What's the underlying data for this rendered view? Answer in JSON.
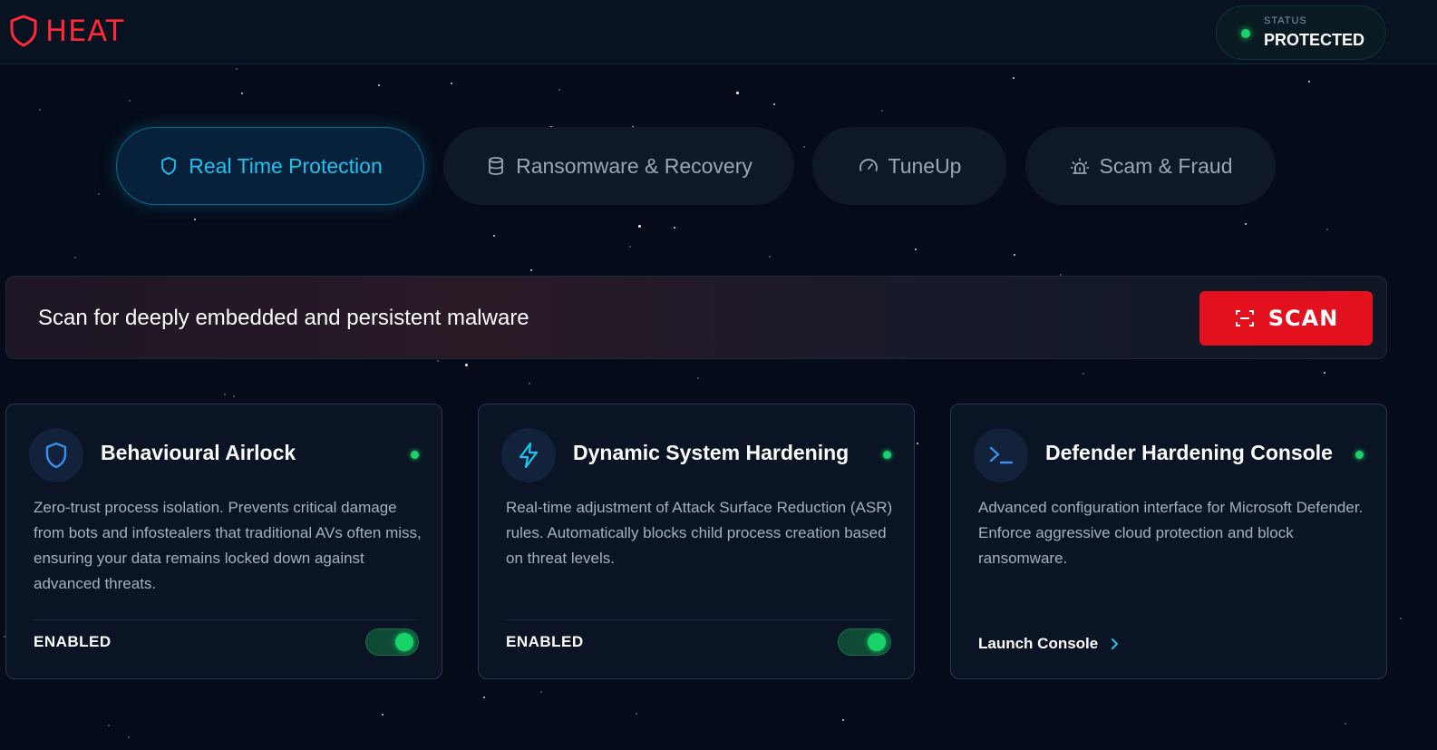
{
  "header": {
    "logo_text": "HEAT",
    "status_label": "STATUS",
    "status_value": "PROTECTED"
  },
  "tabs": [
    {
      "label": "Real Time Protection",
      "icon": "shield-icon",
      "active": true
    },
    {
      "label": "Ransomware & Recovery",
      "icon": "database-icon",
      "active": false
    },
    {
      "label": "TuneUp",
      "icon": "gauge-icon",
      "active": false
    },
    {
      "label": "Scam & Fraud",
      "icon": "alarm-icon",
      "active": false
    }
  ],
  "scan": {
    "text": "Scan for deeply embedded and persistent malware",
    "button_label": "SCAN",
    "button_icon": "scan-frame-icon"
  },
  "cards": [
    {
      "title": "Behavioural Airlock",
      "icon": "shield-icon",
      "description": "Zero-trust process isolation. Prevents critical damage from bots and infostealers that traditional AVs often miss, ensuring your data remains locked down against advanced threats.",
      "state": "ENABLED",
      "toggle_on": true
    },
    {
      "title": "Dynamic System Hardening",
      "icon": "lightning-icon",
      "description": "Real-time adjustment of Attack Surface Reduction (ASR) rules. Automatically blocks child process creation based on threat levels.",
      "state": "ENABLED",
      "toggle_on": true
    },
    {
      "title": "Defender Hardening Console",
      "icon": "terminal-icon",
      "description": "Advanced configuration interface for Microsoft Defender. Enforce aggressive cloud protection and block ransomware.",
      "link_label": "Launch Console"
    }
  ],
  "colors": {
    "brand": "#ff2a35",
    "accent": "#1fc2f0",
    "status_ok": "#19d36a",
    "scan_button": "#e3101d",
    "background": "#050b18"
  }
}
